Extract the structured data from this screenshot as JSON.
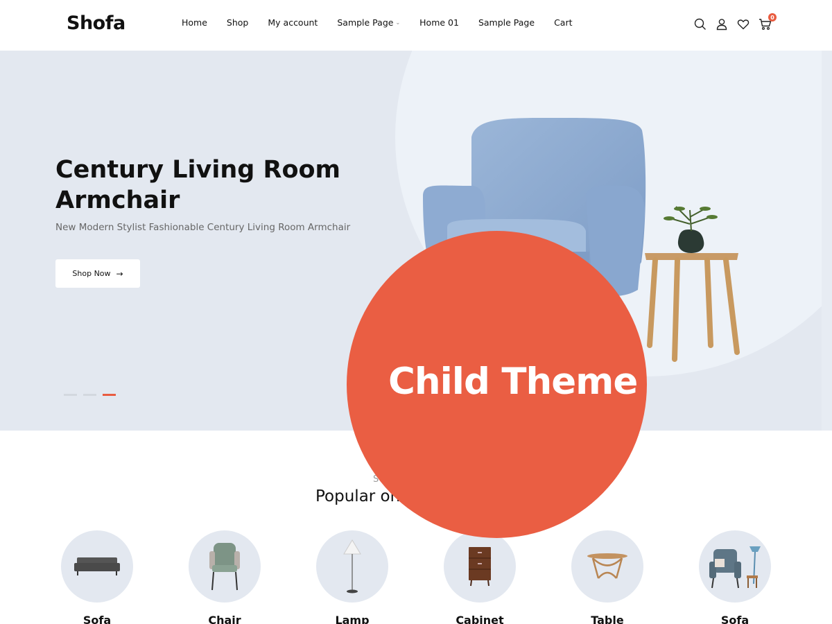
{
  "header": {
    "logo": "Shofa",
    "nav": [
      {
        "label": "Home"
      },
      {
        "label": "Shop"
      },
      {
        "label": "My account"
      },
      {
        "label": "Sample Page"
      },
      {
        "label": "Home 01"
      },
      {
        "label": "Sample Page"
      },
      {
        "label": "Cart"
      }
    ],
    "icons": [
      "search-icon",
      "user-icon",
      "heart-icon",
      "cart-icon"
    ],
    "cart_count": "0"
  },
  "hero": {
    "title": "Century Living Room Armchair",
    "subtitle": "New Modern Stylist Fashionable Century Living Room Armchair",
    "button_label": "Shop Now",
    "slides_total": 3,
    "active_slide": 3
  },
  "popular": {
    "subtitle": "S",
    "title": "Popular on",
    "categories": [
      {
        "label": "Sofa",
        "icon": "sofa-icon"
      },
      {
        "label": "Chair",
        "icon": "chair-icon"
      },
      {
        "label": "Lamp",
        "icon": "lamp-icon"
      },
      {
        "label": "Cabinet",
        "icon": "cabinet-icon"
      },
      {
        "label": "Table",
        "icon": "table-icon"
      },
      {
        "label": "Sofa",
        "icon": "armchair-icon"
      }
    ]
  },
  "badge": {
    "text": "Child Theme"
  },
  "colors": {
    "accent": "#ea5e43",
    "hero_bg": "#e3e8f0",
    "text": "#111111"
  }
}
